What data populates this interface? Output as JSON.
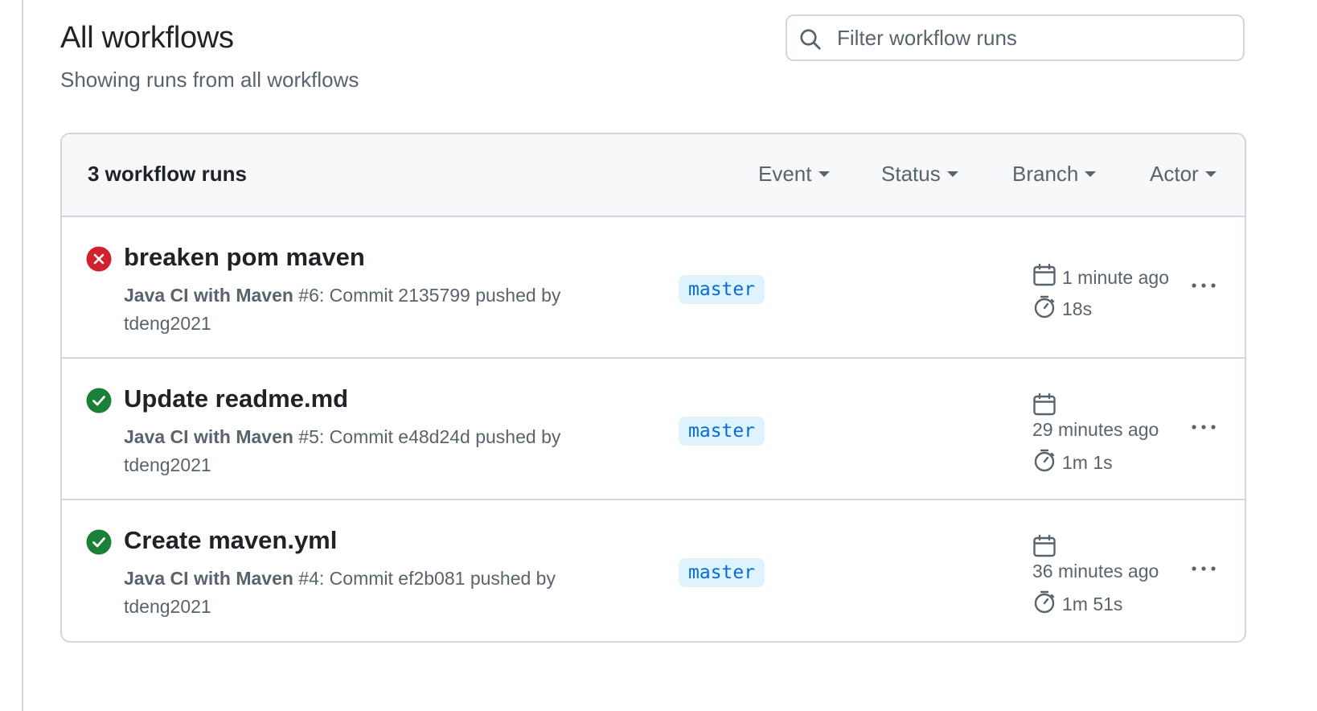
{
  "page": {
    "title": "All workflows",
    "subtitle": "Showing runs from all workflows"
  },
  "search": {
    "placeholder": "Filter workflow runs",
    "icon": "search-icon"
  },
  "runs_header": {
    "count_label": "3 workflow runs",
    "filters": [
      "Event",
      "Status",
      "Branch",
      "Actor"
    ]
  },
  "colors": {
    "success": "#1a7f37",
    "failure": "#cf222e",
    "branch_bg": "#ddf4ff",
    "branch_text": "#0969da"
  },
  "runs": [
    {
      "status": "failure",
      "title": "breaken pom maven",
      "workflow": "Java CI with Maven",
      "detail": " #6: Commit 2135799 pushed by",
      "actor": "tdeng2021",
      "branch": "master",
      "time_ago": "1 minute ago",
      "duration": "18s"
    },
    {
      "status": "success",
      "title": "Update readme.md",
      "workflow": "Java CI with Maven",
      "detail": " #5: Commit e48d24d pushed by",
      "actor": "tdeng2021",
      "branch": "master",
      "time_ago": "29 minutes ago",
      "duration": "1m 1s"
    },
    {
      "status": "success",
      "title": "Create maven.yml",
      "workflow": "Java CI with Maven",
      "detail": " #4: Commit ef2b081 pushed by",
      "actor": "tdeng2021",
      "branch": "master",
      "time_ago": "36 minutes ago",
      "duration": "1m 51s"
    }
  ]
}
